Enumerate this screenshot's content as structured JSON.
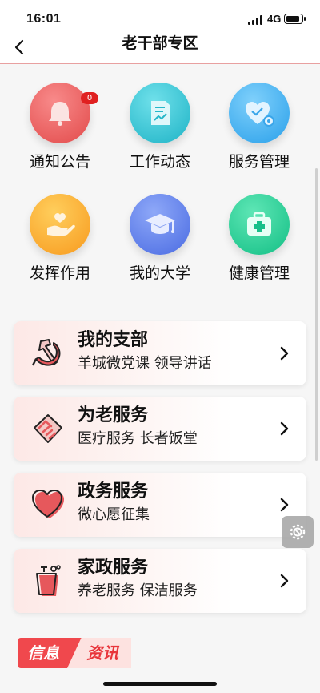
{
  "status_bar": {
    "time": "16:01",
    "network": "4G"
  },
  "nav": {
    "title": "老干部专区"
  },
  "grid": {
    "items": [
      {
        "label": "通知公告",
        "badge": "0"
      },
      {
        "label": "工作动态"
      },
      {
        "label": "服务管理"
      },
      {
        "label": "发挥作用"
      },
      {
        "label": "我的大学"
      },
      {
        "label": "健康管理"
      }
    ]
  },
  "cards": [
    {
      "title": "我的支部",
      "subtitle": "羊城微党课 领导讲话"
    },
    {
      "title": "为老服务",
      "subtitle": "医疗服务 长者饭堂"
    },
    {
      "title": "政务服务",
      "subtitle": "微心愿征集"
    },
    {
      "title": "家政服务",
      "subtitle": "养老服务 保洁服务"
    }
  ],
  "info_banner": {
    "part1": "信息",
    "part2": "资讯"
  },
  "colors": {
    "accent_red": "#f0484d",
    "nav_border": "#e8a0a0",
    "card_gradient_start": "#fde8e6"
  }
}
